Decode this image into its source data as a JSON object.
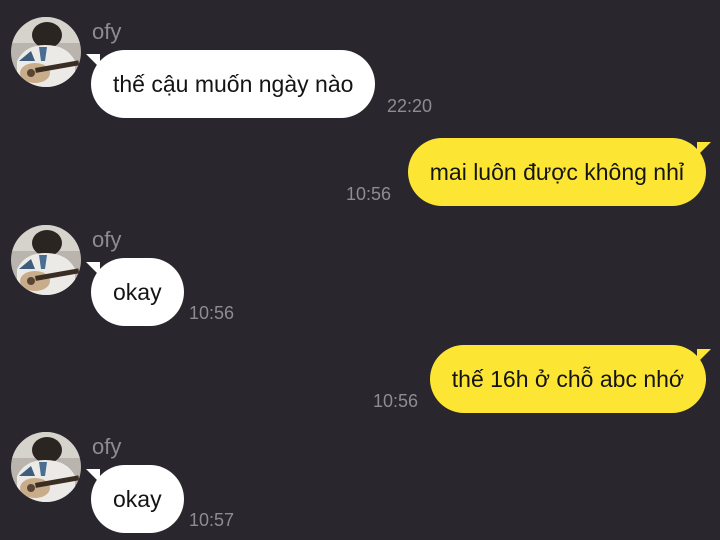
{
  "chat": {
    "contact_name": "ofy",
    "messages": [
      {
        "from": "ofy",
        "direction": "incoming",
        "text": "thế cậu muốn ngày nào",
        "time": "22:20"
      },
      {
        "from": "me",
        "direction": "outgoing",
        "text": "mai luôn được không nhỉ",
        "time": "10:56"
      },
      {
        "from": "ofy",
        "direction": "incoming",
        "text": "okay",
        "time": "10:56"
      },
      {
        "from": "me",
        "direction": "outgoing",
        "text": "thế 16h ở chỗ abc nhớ",
        "time": "10:56"
      },
      {
        "from": "ofy",
        "direction": "incoming",
        "text": "okay",
        "time": "10:57"
      }
    ]
  },
  "colors": {
    "background": "#29262d",
    "incoming_bubble": "#ffffff",
    "outgoing_bubble": "#fde633",
    "meta_text": "#8e8b92"
  }
}
